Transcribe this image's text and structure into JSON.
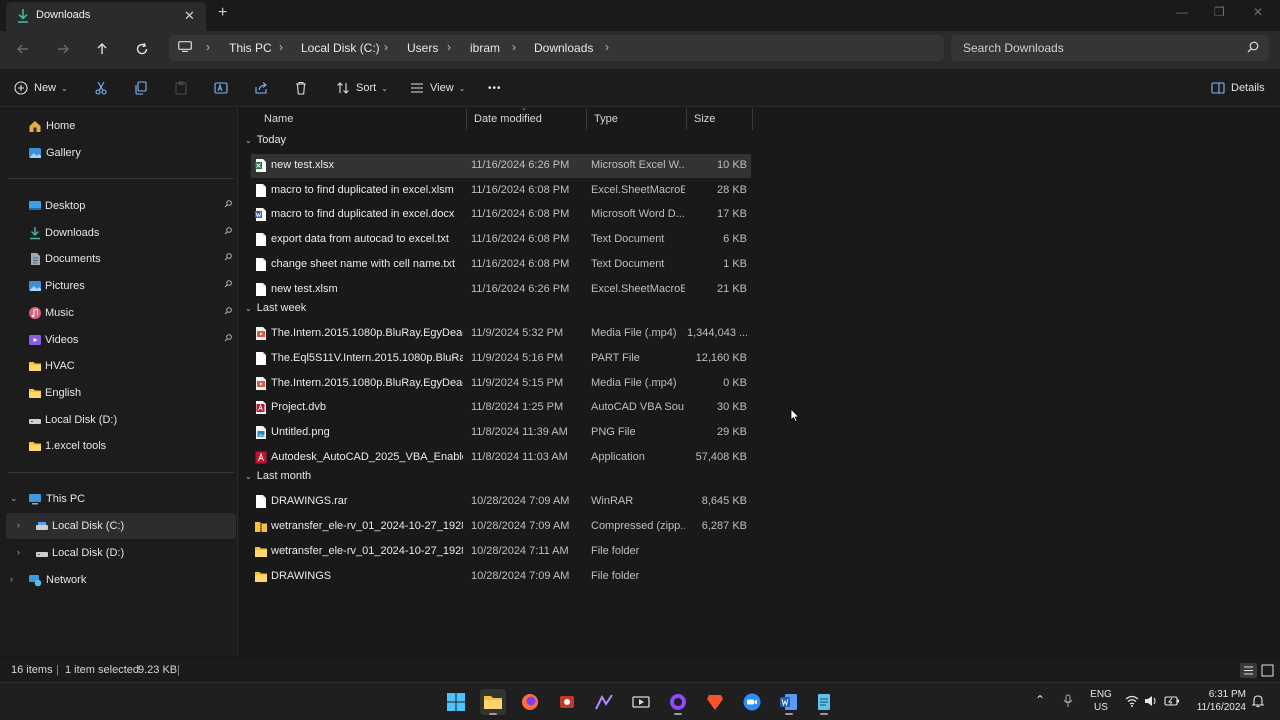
{
  "window": {
    "tab_title": "Downloads",
    "tab_close": "✕",
    "new_tab": "+",
    "minimize": "—",
    "maximize": "❐",
    "close": "✕"
  },
  "address": {
    "breadcrumbs": [
      "This PC",
      "Local Disk (C:)",
      "Users",
      "ibram",
      "Downloads"
    ],
    "separator": "›",
    "search_placeholder": "Search Downloads"
  },
  "toolbar": {
    "new_label": "New",
    "sort_label": "Sort",
    "view_label": "View",
    "more_label": "•••",
    "details_label": "Details",
    "caret": "⌄"
  },
  "sidebar": {
    "home": "Home",
    "gallery": "Gallery",
    "quick": [
      {
        "label": "Desktop",
        "icon": "desktop-icon",
        "pinned": true
      },
      {
        "label": "Downloads",
        "icon": "download-icon",
        "pinned": true
      },
      {
        "label": "Documents",
        "icon": "document-icon",
        "pinned": true
      },
      {
        "label": "Pictures",
        "icon": "pictures-icon",
        "pinned": true
      },
      {
        "label": "Music",
        "icon": "music-icon",
        "pinned": true
      },
      {
        "label": "Videos",
        "icon": "videos-icon",
        "pinned": true
      },
      {
        "label": "HVAC",
        "icon": "folder-icon",
        "pinned": false
      },
      {
        "label": "English",
        "icon": "folder-icon",
        "pinned": false
      },
      {
        "label": "Local Disk (D:)",
        "icon": "drive-icon",
        "pinned": false
      },
      {
        "label": "1.excel tools",
        "icon": "folder-icon",
        "pinned": false
      }
    ],
    "this_pc": "This PC",
    "local_c": "Local Disk (C:)",
    "local_d": "Local Disk (D:)",
    "network": "Network"
  },
  "columns": {
    "name": "Name",
    "date": "Date modified",
    "type": "Type",
    "size": "Size"
  },
  "groups": [
    {
      "label": "Today",
      "files": [
        {
          "name": "new test.xlsx",
          "date": "11/16/2024 6:26 PM",
          "type": "Microsoft Excel W...",
          "size": "10 KB",
          "icon": "excel",
          "selected": true
        },
        {
          "name": "macro to find duplicated in excel.xlsm",
          "date": "11/16/2024 6:08 PM",
          "type": "Excel.SheetMacroE...",
          "size": "28 KB",
          "icon": "blank"
        },
        {
          "name": "macro to find duplicated in excel.docx",
          "date": "11/16/2024 6:08 PM",
          "type": "Microsoft Word D...",
          "size": "17 KB",
          "icon": "word"
        },
        {
          "name": "export data from autocad to excel.txt",
          "date": "11/16/2024 6:08 PM",
          "type": "Text Document",
          "size": "6 KB",
          "icon": "blank"
        },
        {
          "name": "change sheet name with cell name.txt",
          "date": "11/16/2024 6:08 PM",
          "type": "Text Document",
          "size": "1 KB",
          "icon": "blank"
        },
        {
          "name": "new test.xlsm",
          "date": "11/16/2024 6:26 PM",
          "type": "Excel.SheetMacroE...",
          "size": "21 KB",
          "icon": "blank"
        }
      ]
    },
    {
      "label": "Last week",
      "files": [
        {
          "name": "The.Intern.2015.1080p.BluRay.EgyDead.C...",
          "date": "11/9/2024 5:32 PM",
          "type": "Media File (.mp4)",
          "size": "1,344,043 ...",
          "icon": "media"
        },
        {
          "name": "The.Eql5S11V.Intern.2015.1080p.BluRay.E...",
          "date": "11/9/2024 5:16 PM",
          "type": "PART File",
          "size": "12,160 KB",
          "icon": "blank"
        },
        {
          "name": "The.Intern.2015.1080p.BluRay.EgyDead.C...",
          "date": "11/9/2024 5:15 PM",
          "type": "Media File (.mp4)",
          "size": "0 KB",
          "icon": "media"
        },
        {
          "name": "Project.dvb",
          "date": "11/8/2024 1:25 PM",
          "type": "AutoCAD VBA Sou...",
          "size": "30 KB",
          "icon": "autocad"
        },
        {
          "name": "Untitled.png",
          "date": "11/8/2024 11:39 AM",
          "type": "PNG File",
          "size": "29 KB",
          "icon": "png"
        },
        {
          "name": "Autodesk_AutoCAD_2025_VBA_Enabler.e...",
          "date": "11/8/2024 11:03 AM",
          "type": "Application",
          "size": "57,408 KB",
          "icon": "app"
        }
      ]
    },
    {
      "label": "Last month",
      "files": [
        {
          "name": "DRAWINGS.rar",
          "date": "10/28/2024 7:09 AM",
          "type": "WinRAR",
          "size": "8,645 KB",
          "icon": "blank"
        },
        {
          "name": "wetransfer_ele-rv_01_2024-10-27_1928.zip",
          "date": "10/28/2024 7:09 AM",
          "type": "Compressed (zipp...",
          "size": "6,287 KB",
          "icon": "zip"
        },
        {
          "name": "wetransfer_ele-rv_01_2024-10-27_1928",
          "date": "10/28/2024 7:11 AM",
          "type": "File folder",
          "size": "",
          "icon": "folder"
        },
        {
          "name": "DRAWINGS",
          "date": "10/28/2024 7:09 AM",
          "type": "File folder",
          "size": "",
          "icon": "folder"
        }
      ]
    }
  ],
  "status": {
    "items": "16 items",
    "selected": "1 item selected",
    "selected_size": "9.23 KB",
    "sep": "|"
  },
  "tray": {
    "lang_1": "ENG",
    "lang_2": "US",
    "time": "6:31 PM",
    "date": "11/16/2024"
  },
  "colors": {
    "accent": "#4cc2ff",
    "folder": "#f4c23b",
    "excel": "#1f7244",
    "word": "#2b5eb8",
    "autocad": "#c8102e"
  }
}
